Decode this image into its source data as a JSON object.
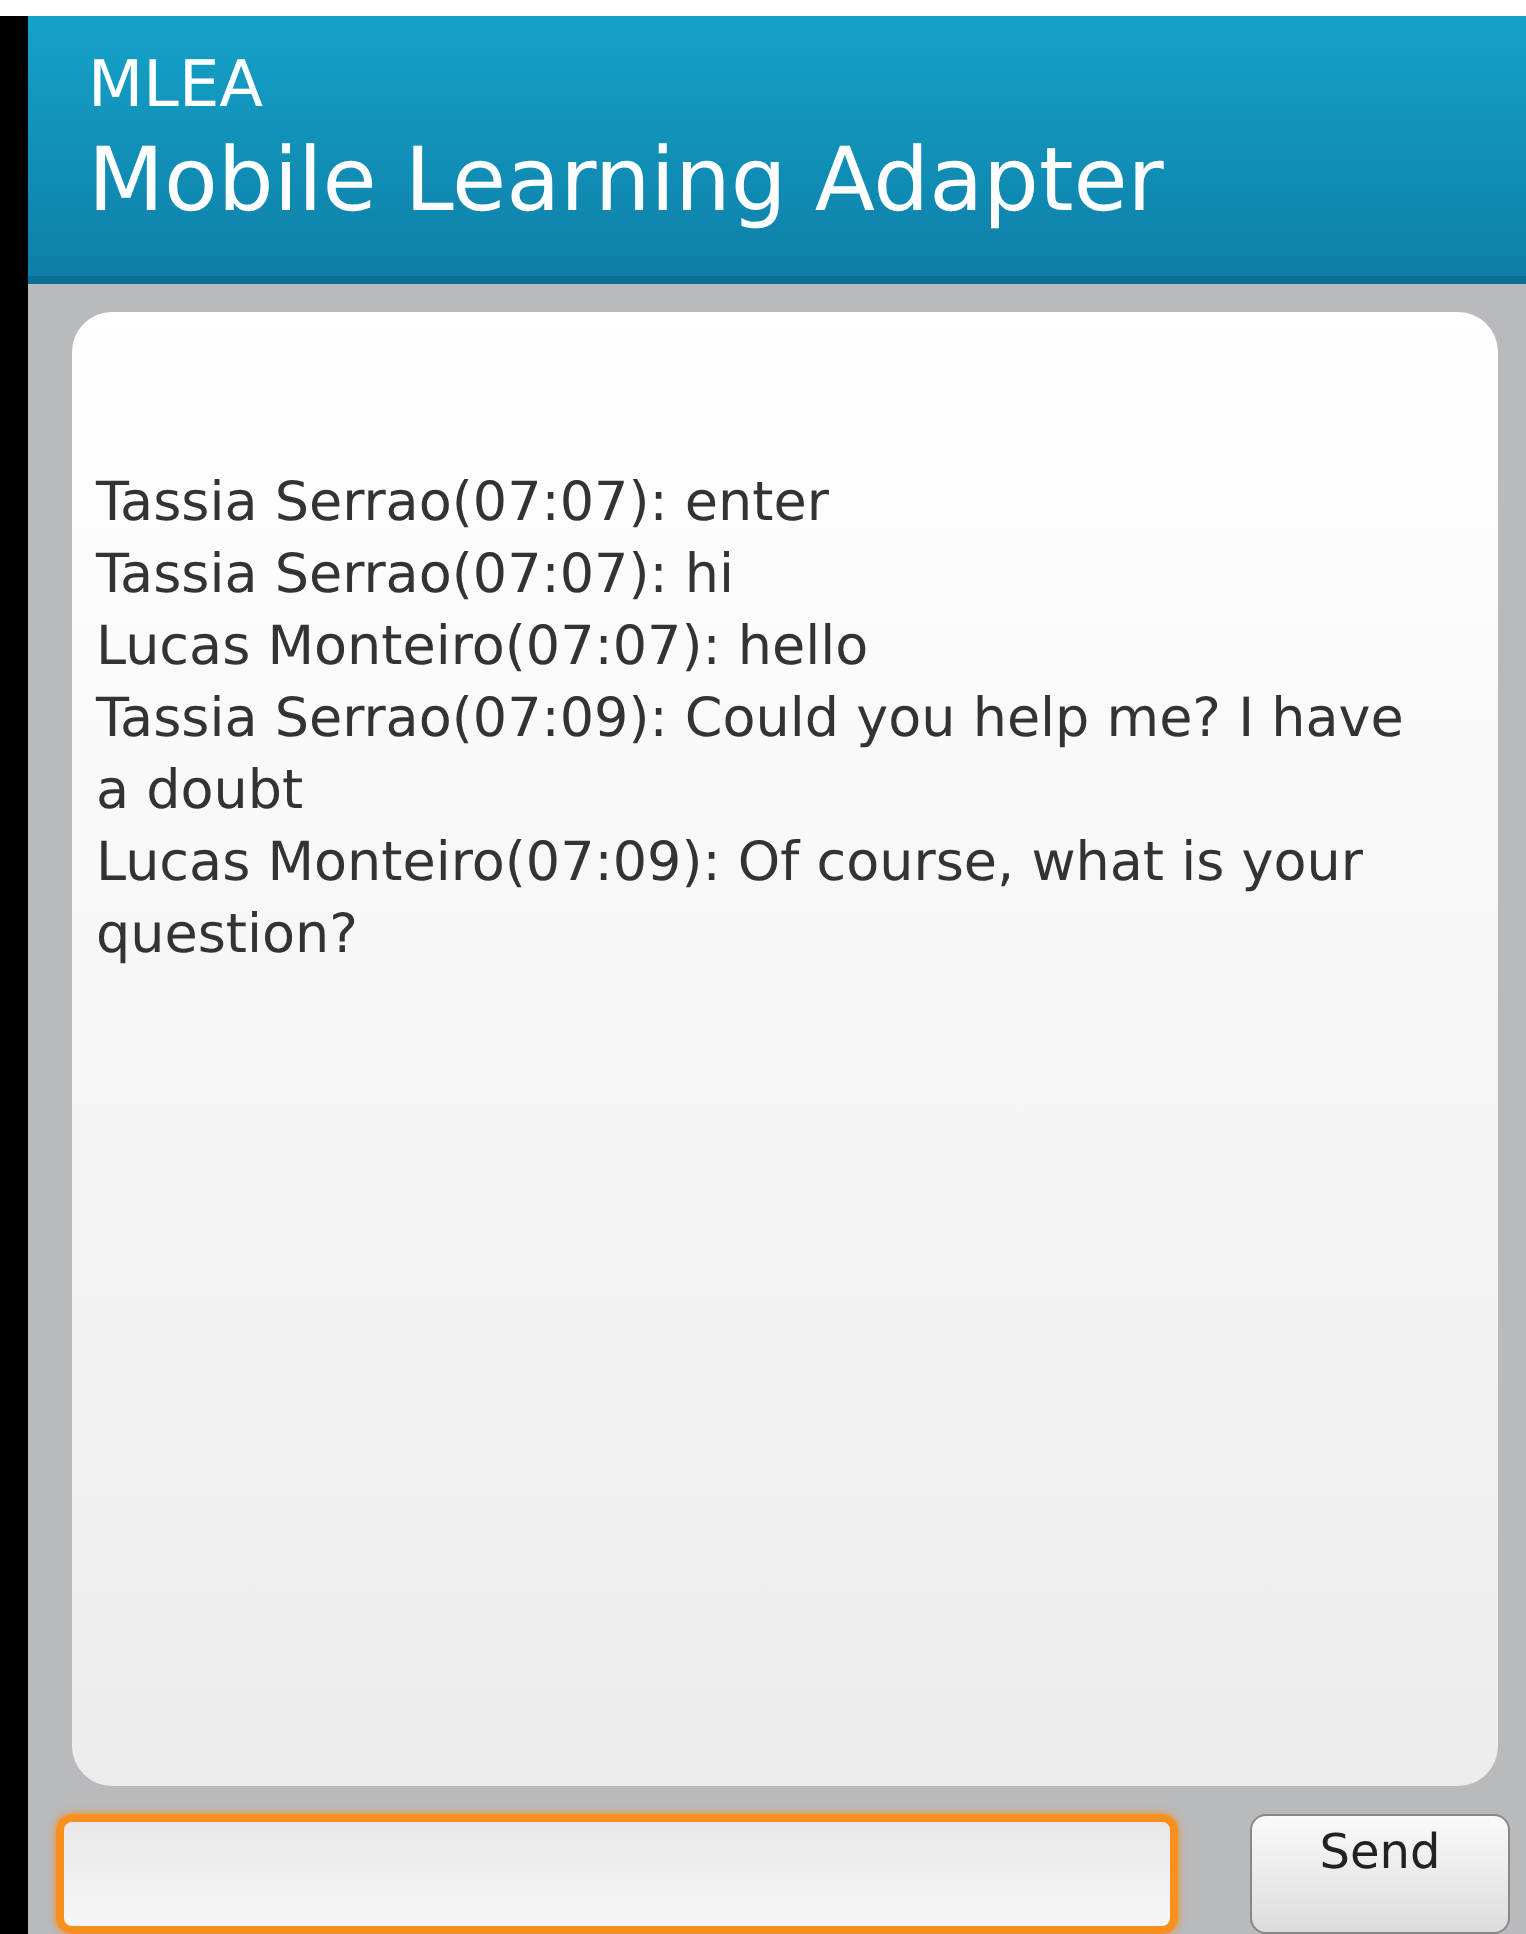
{
  "header": {
    "app_name": "MLEA",
    "title": "Mobile Learning Adapter"
  },
  "messages": [
    {
      "text": "Tassia Serrao(07:07): enter"
    },
    {
      "text": "Tassia Serrao(07:07): hi"
    },
    {
      "text": "Lucas Monteiro(07:07): hello"
    },
    {
      "text": "Tassia Serrao(07:09): Could you help me? I have a doubt"
    },
    {
      "text": "Lucas Monteiro(07:09): Of course, what is your question?"
    }
  ],
  "composer": {
    "focused": true,
    "send_label": "Send"
  }
}
